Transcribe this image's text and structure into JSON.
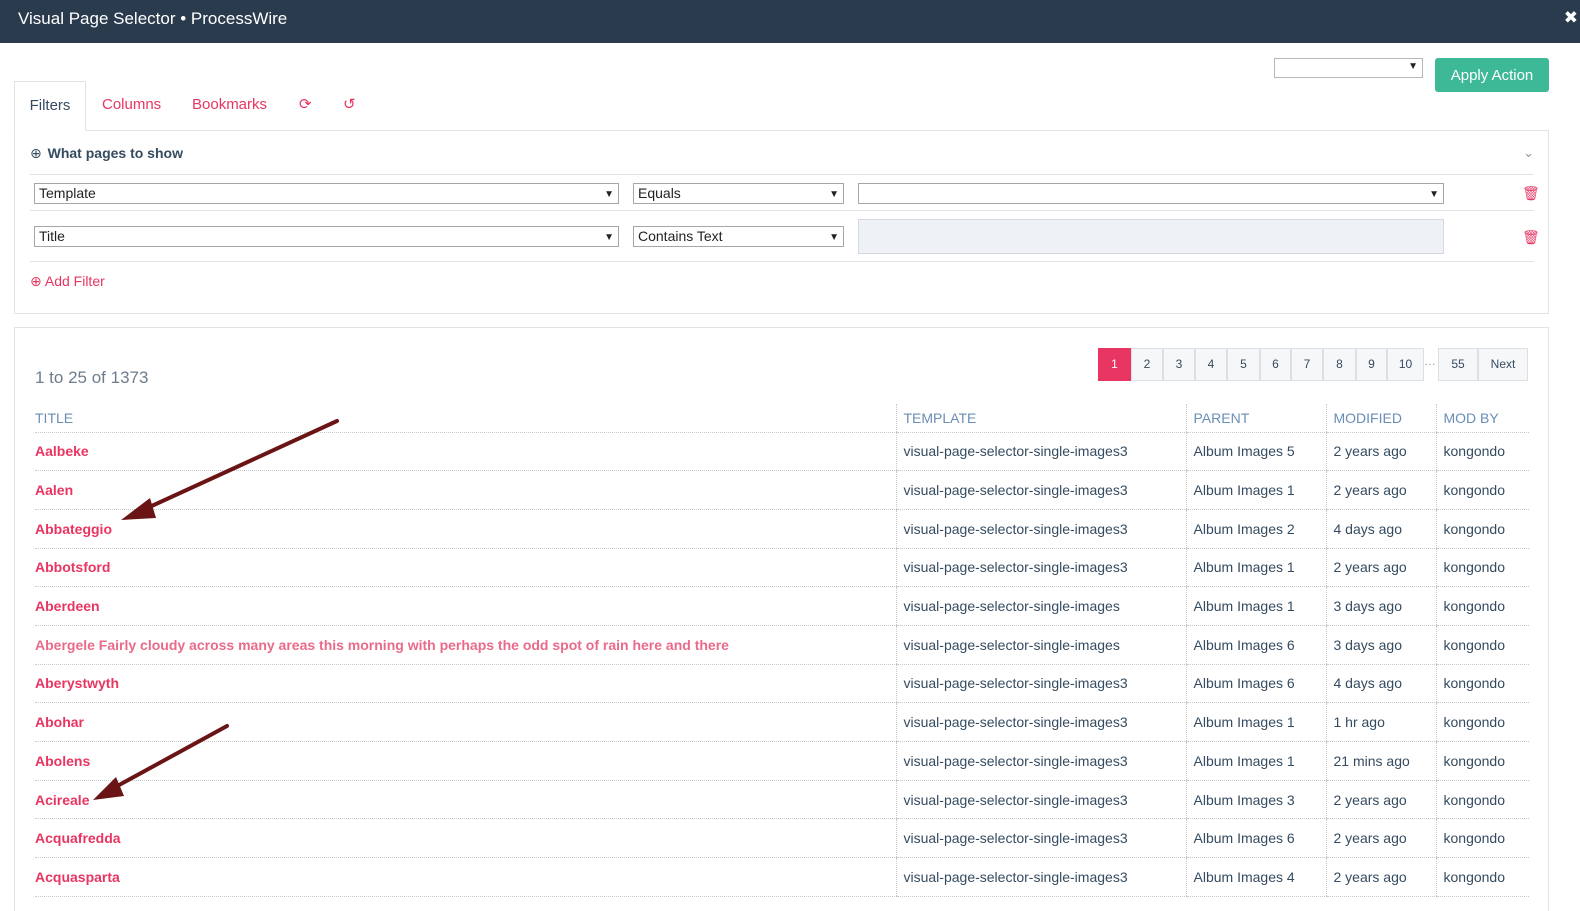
{
  "window": {
    "title": "Visual Page Selector • ProcessWire",
    "close_glyph": "✖"
  },
  "actions": {
    "select_value": "",
    "apply_label": "Apply Action"
  },
  "tabs": {
    "filters": "Filters",
    "columns": "Columns",
    "bookmarks": "Bookmarks",
    "refresh_glyph": "⟳",
    "reset_glyph": "↺"
  },
  "filters": {
    "heading": "What pages to show",
    "heading_icon": "⊕",
    "toggle_glyph": "⌄",
    "rows": [
      {
        "field": "Template",
        "operator": "Equals",
        "value": ""
      },
      {
        "field": "Title",
        "operator": "Contains Text",
        "value": ""
      }
    ],
    "add_label": "Add Filter",
    "add_icon": "⊕",
    "trash_glyph": "🗑"
  },
  "results": {
    "count_text": "1 to 25 of 1373",
    "pagination": [
      "1",
      "2",
      "3",
      "4",
      "5",
      "6",
      "7",
      "8",
      "9",
      "10",
      "…",
      "55",
      "Next"
    ],
    "columns": [
      "TITLE",
      "TEMPLATE",
      "PARENT",
      "MODIFIED",
      "MOD BY"
    ],
    "rows": [
      {
        "title": "Aalbeke",
        "template": "visual-page-selector-single-images3",
        "parent": "Album Images 5",
        "modified": "2 years ago",
        "mod_by": "kongondo"
      },
      {
        "title": "Aalen",
        "template": "visual-page-selector-single-images3",
        "parent": "Album Images 1",
        "modified": "2 years ago",
        "mod_by": "kongondo"
      },
      {
        "title": "Abbateggio",
        "template": "visual-page-selector-single-images3",
        "parent": "Album Images 2",
        "modified": "4 days ago",
        "mod_by": "kongondo"
      },
      {
        "title": "Abbotsford",
        "template": "visual-page-selector-single-images3",
        "parent": "Album Images 1",
        "modified": "2 years ago",
        "mod_by": "kongondo"
      },
      {
        "title": "Aberdeen",
        "template": "visual-page-selector-single-images",
        "parent": "Album Images 1",
        "modified": "3 days ago",
        "mod_by": "kongondo"
      },
      {
        "title": "Abergele Fairly cloudy across many areas this morning with perhaps the odd spot of rain here and there",
        "template": "visual-page-selector-single-images",
        "parent": "Album Images 6",
        "modified": "3 days ago",
        "mod_by": "kongondo"
      },
      {
        "title": "Aberystwyth",
        "template": "visual-page-selector-single-images3",
        "parent": "Album Images 6",
        "modified": "4 days ago",
        "mod_by": "kongondo"
      },
      {
        "title": "Abohar",
        "template": "visual-page-selector-single-images3",
        "parent": "Album Images 1",
        "modified": "1 hr ago",
        "mod_by": "kongondo"
      },
      {
        "title": "Abolens",
        "template": "visual-page-selector-single-images3",
        "parent": "Album Images 1",
        "modified": "21 mins ago",
        "mod_by": "kongondo"
      },
      {
        "title": "Acireale",
        "template": "visual-page-selector-single-images3",
        "parent": "Album Images 3",
        "modified": "2 years ago",
        "mod_by": "kongondo"
      },
      {
        "title": "Acquafredda",
        "template": "visual-page-selector-single-images3",
        "parent": "Album Images 6",
        "modified": "2 years ago",
        "mod_by": "kongondo"
      },
      {
        "title": "Acquasparta",
        "template": "visual-page-selector-single-images3",
        "parent": "Album Images 4",
        "modified": "2 years ago",
        "mod_by": "kongondo"
      }
    ]
  },
  "colors": {
    "accent": "#e83561",
    "titlebar": "#2b3b4e",
    "apply": "#3eb998",
    "arrow": "#6b1416"
  }
}
